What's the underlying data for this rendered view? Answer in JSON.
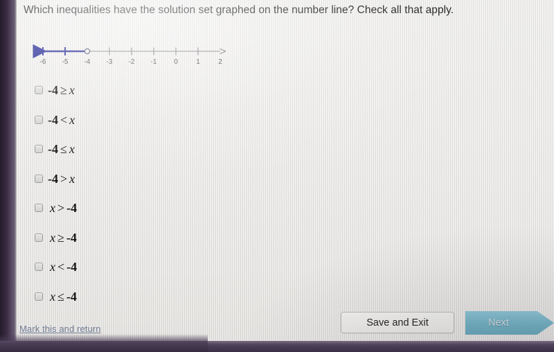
{
  "question": {
    "text": "Which inequalities have the solution set graphed on the number line? Check all that apply."
  },
  "number_line": {
    "ticks": [
      "-6",
      "-5",
      "-4",
      "-3",
      "-2",
      "-1",
      "0",
      "1",
      "2"
    ],
    "tick_values": [
      -6,
      -5,
      -4,
      -3,
      -2,
      -1,
      0,
      1,
      2
    ],
    "endpoint_value": -4,
    "endpoint_type": "open-circle",
    "ray_direction": "left",
    "ray_color": "#151a8c",
    "axis_color": "#6d6d6d",
    "left_arrow": true,
    "right_arrow": true,
    "represents": "x < -4"
  },
  "options": [
    {
      "id": "opt-1",
      "checked": false,
      "left": "-4",
      "op": "≥",
      "right": "x",
      "text": "-4 ≥ x",
      "left_is_var": false
    },
    {
      "id": "opt-2",
      "checked": false,
      "left": "-4",
      "op": "<",
      "right": "x",
      "text": "-4 < x",
      "left_is_var": false
    },
    {
      "id": "opt-3",
      "checked": false,
      "left": "-4",
      "op": "≤",
      "right": "x",
      "text": "-4 ≤ x",
      "left_is_var": false
    },
    {
      "id": "opt-4",
      "checked": false,
      "left": "-4",
      "op": ">",
      "right": "x",
      "text": "-4 > x",
      "left_is_var": false
    },
    {
      "id": "opt-5",
      "checked": false,
      "left": "x",
      "op": ">",
      "right": "-4",
      "text": "x > -4",
      "left_is_var": true
    },
    {
      "id": "opt-6",
      "checked": false,
      "left": "x",
      "op": "≥",
      "right": "-4",
      "text": "x ≥ -4",
      "left_is_var": true
    },
    {
      "id": "opt-7",
      "checked": false,
      "left": "x",
      "op": "<",
      "right": "-4",
      "text": "x < -4",
      "left_is_var": true
    },
    {
      "id": "opt-8",
      "checked": false,
      "left": "x",
      "op": "≤",
      "right": "-4",
      "text": "x ≤ -4",
      "left_is_var": true
    }
  ],
  "footer": {
    "mark_link": "Mark this and return",
    "save_exit_label": "Save and Exit",
    "next_label": "Next"
  },
  "colors": {
    "page_background": "#e9e7e4",
    "frame": "#3b2f45",
    "ray": "#151a8c",
    "next_button": "#6aadc0",
    "link": "#6f7b93"
  }
}
